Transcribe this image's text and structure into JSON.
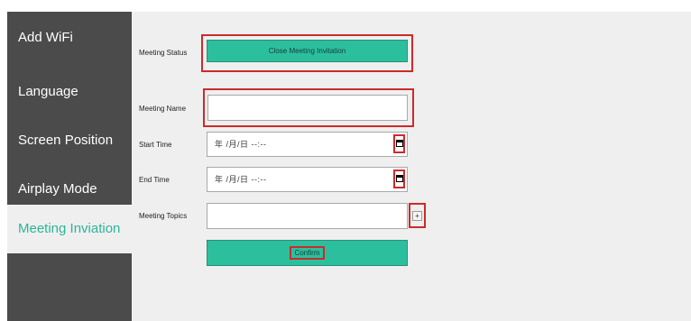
{
  "sidebar": {
    "items": [
      {
        "label": "Add WiFi"
      },
      {
        "label": "Language"
      },
      {
        "label": "Screen Position"
      },
      {
        "label": "Airplay Mode"
      },
      {
        "label": "Meeting Inviation"
      }
    ],
    "active_index": 4
  },
  "form": {
    "meeting_status_label": "Meeting Status",
    "close_invitation_button": "Close Meeting Invitation",
    "meeting_name_label": "Meeting Name",
    "meeting_name_value": "",
    "start_time_label": "Start Time",
    "start_time_value": "年 /月/日 --:--",
    "end_time_label": "End Time",
    "end_time_value": "年 /月/日 --:--",
    "meeting_topics_label": "Meeting Topics",
    "meeting_topics_value": "",
    "add_topic_symbol": "+",
    "confirm_button": "Confirm"
  },
  "colors": {
    "sidebar_bg": "#4b4b4b",
    "accent_green": "#2bbf9e",
    "active_text": "#2bb59a",
    "highlight_red": "#cc2b2b",
    "content_bg": "#efefef"
  },
  "icons": {
    "calendar": "calendar-icon",
    "plus": "plus-icon"
  }
}
